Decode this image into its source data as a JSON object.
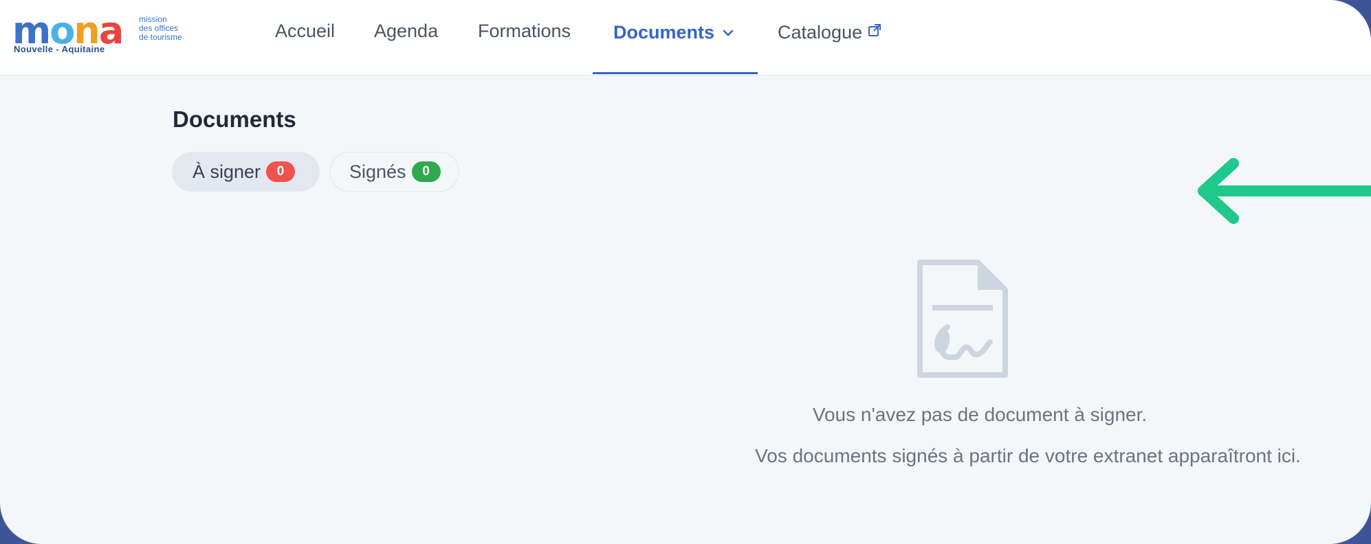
{
  "logo": {
    "word_m": "m",
    "word_o": "o",
    "word_n": "n",
    "word_a": "a",
    "subtitle": "Nouvelle - Aquitaine",
    "tagline_1": "mission",
    "tagline_2": "des offices",
    "tagline_3": "de tourisme"
  },
  "nav": {
    "items": [
      {
        "label": "Accueil"
      },
      {
        "label": "Agenda"
      },
      {
        "label": "Formations"
      },
      {
        "label": "Documents"
      },
      {
        "label": "Catalogue"
      }
    ],
    "active": "Documents"
  },
  "main": {
    "title": "Documents",
    "tabs": [
      {
        "label": "À signer",
        "count": "0",
        "badge_color": "#ef5350"
      },
      {
        "label": "Signés",
        "count": "0",
        "badge_color": "#2fa84f"
      }
    ],
    "empty_state": {
      "icon": "signed-document-icon",
      "line_1": "Vous n'avez pas de document à signer.",
      "line_2": "Vos documents signés à partir de votre extranet apparaîtront ici."
    }
  },
  "annotation": {
    "icon": "left-arrow-icon",
    "color": "#1ec98a"
  },
  "colors": {
    "accent": "#3563c9",
    "background": "#f4f7fa",
    "frame": "#3d5498"
  }
}
